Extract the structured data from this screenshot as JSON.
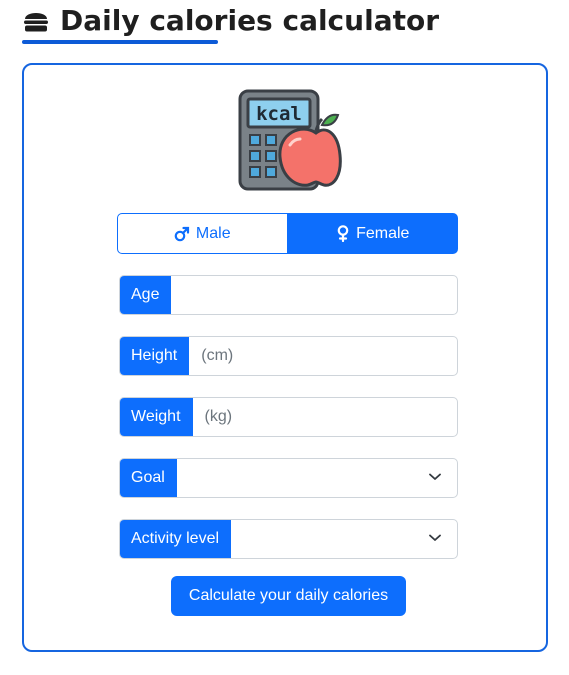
{
  "header": {
    "title": "Daily calories calculator",
    "icon": "burger-icon"
  },
  "logo": {
    "text": "kcal",
    "icon": "calculator-apple-icon"
  },
  "gender": {
    "options": [
      {
        "label": "Male",
        "icon": "male-icon",
        "selected": false
      },
      {
        "label": "Female",
        "icon": "female-icon",
        "selected": true
      }
    ]
  },
  "form": {
    "age": {
      "label": "Age",
      "placeholder": "",
      "value": ""
    },
    "height": {
      "label": "Height",
      "placeholder": "(cm)",
      "value": ""
    },
    "weight": {
      "label": "Weight",
      "placeholder": "(kg)",
      "value": ""
    },
    "goal": {
      "label": "Goal",
      "value": ""
    },
    "activity": {
      "label": "Activity level",
      "value": ""
    }
  },
  "submit": {
    "label": "Calculate your daily calories"
  },
  "colors": {
    "primary": "#0d6efd",
    "card_border": "#1565e0",
    "underline": "#0d5bd7"
  }
}
